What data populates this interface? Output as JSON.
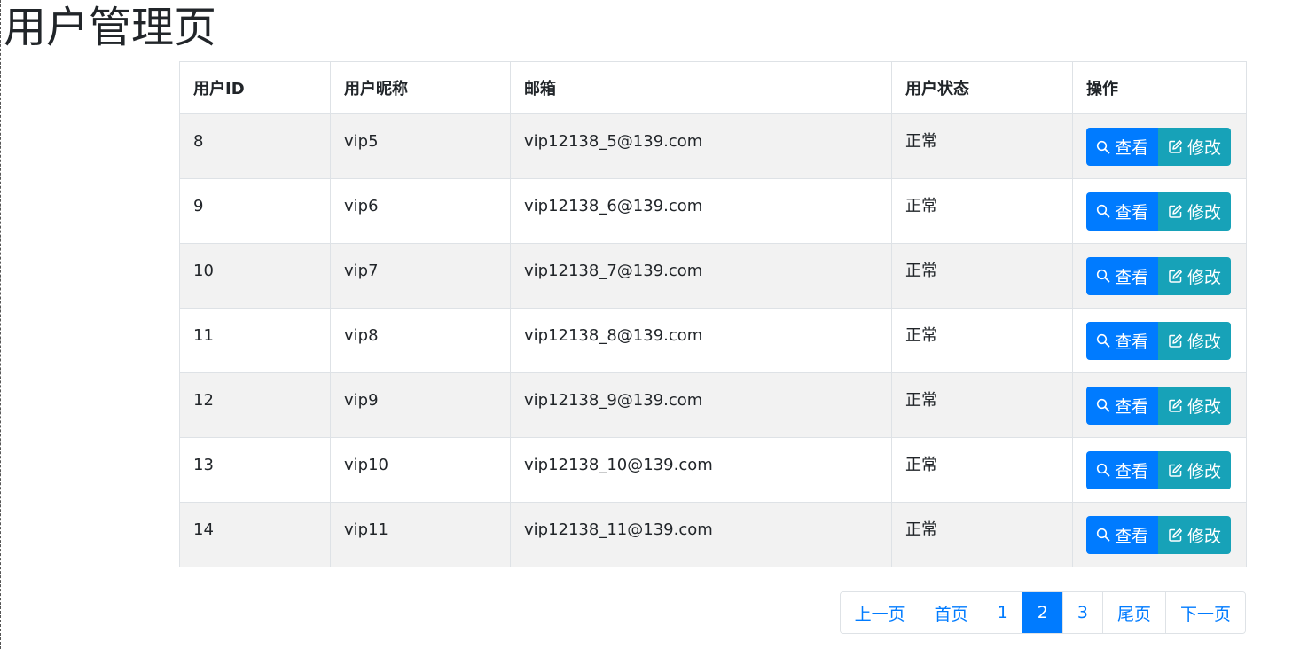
{
  "page": {
    "title": "用户管理页"
  },
  "table": {
    "headers": [
      "用户ID",
      "用户昵称",
      "邮箱",
      "用户状态",
      "操作"
    ],
    "rows": [
      {
        "id": "8",
        "nickname": "vip5",
        "email": "vip12138_5@139.com",
        "status": "正常"
      },
      {
        "id": "9",
        "nickname": "vip6",
        "email": "vip12138_6@139.com",
        "status": "正常"
      },
      {
        "id": "10",
        "nickname": "vip7",
        "email": "vip12138_7@139.com",
        "status": "正常"
      },
      {
        "id": "11",
        "nickname": "vip8",
        "email": "vip12138_8@139.com",
        "status": "正常"
      },
      {
        "id": "12",
        "nickname": "vip9",
        "email": "vip12138_9@139.com",
        "status": "正常"
      },
      {
        "id": "13",
        "nickname": "vip10",
        "email": "vip12138_10@139.com",
        "status": "正常"
      },
      {
        "id": "14",
        "nickname": "vip11",
        "email": "vip12138_11@139.com",
        "status": "正常"
      }
    ],
    "actions": {
      "view_label": "查看",
      "view_icon": "search-icon",
      "edit_label": "修改",
      "edit_icon": "edit-icon"
    }
  },
  "pagination": {
    "prev": "上一页",
    "first": "首页",
    "pages": [
      "1",
      "2",
      "3"
    ],
    "current": "2",
    "last": "尾页",
    "next": "下一页"
  },
  "colors": {
    "primary": "#007bff",
    "info": "#17a2b8",
    "stripe": "#f2f2f2"
  }
}
